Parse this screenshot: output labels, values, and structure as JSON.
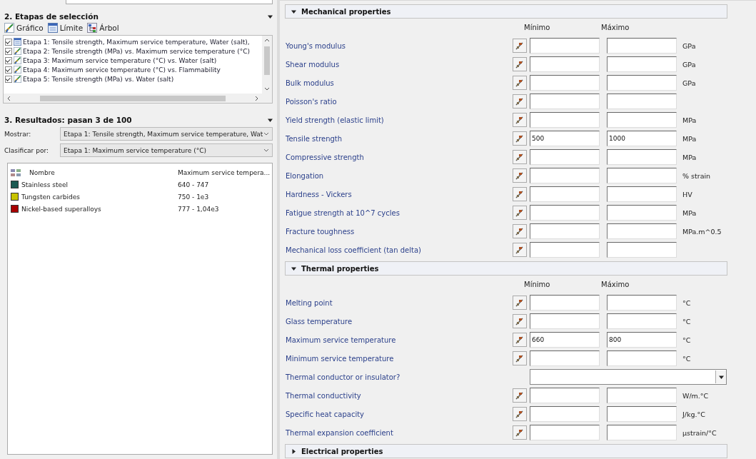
{
  "selection_stages": {
    "title": "2. Etapas de selección",
    "toolbar": [
      {
        "label": "Gráfico",
        "kind": "chart"
      },
      {
        "label": "Límite",
        "kind": "limit"
      },
      {
        "label": "Árbol",
        "kind": "tree"
      }
    ],
    "stages": [
      {
        "label": "Etapa 1: Tensile strength, Maximum service temperature, Water (salt),",
        "kind": "limit",
        "checked": true
      },
      {
        "label": "Etapa 2: Tensile strength (MPa) vs. Maximum service temperature (°C)",
        "kind": "chart",
        "checked": true
      },
      {
        "label": "Etapa 3: Maximum service temperature (°C) vs. Water (salt)",
        "kind": "chart",
        "checked": true
      },
      {
        "label": "Etapa 4: Maximum service temperature (°C) vs. Flammability",
        "kind": "chart",
        "checked": true
      },
      {
        "label": "Etapa 5: Tensile strength (MPa) vs. Water (salt)",
        "kind": "chart",
        "checked": true
      }
    ]
  },
  "results": {
    "title": "3. Resultados: pasan 3 de 100",
    "show_label": "Mostrar:",
    "show_value": "Etapa 1: Tensile strength, Maximum service temperature, Wat",
    "sort_label": "Clasificar por:",
    "sort_value": "Etapa 1: Maximum service temperature (°C)",
    "columns": [
      "Nombre",
      "Maximum service tempera..."
    ],
    "rows": [
      {
        "name": "Stainless steel",
        "value": "640 - 747",
        "color": "#1c5a52"
      },
      {
        "name": "Tungsten carbides",
        "value": "750 - 1e3",
        "color": "#c8c400"
      },
      {
        "name": "Nickel-based superalloys",
        "value": "777 - 1,04e3",
        "color": "#a80000"
      }
    ]
  },
  "property_groups": [
    {
      "title": "Mechanical properties",
      "expanded": true,
      "min_heading": "Mínimo",
      "max_heading": "Máximo",
      "properties": [
        {
          "label": "Young's modulus",
          "kind": "range",
          "unit": "GPa"
        },
        {
          "label": "Shear modulus",
          "kind": "range",
          "unit": "GPa"
        },
        {
          "label": "Bulk modulus",
          "kind": "range",
          "unit": "GPa"
        },
        {
          "label": "Poisson's ratio",
          "kind": "range"
        },
        {
          "label": "Yield strength (elastic limit)",
          "kind": "range",
          "unit": "MPa"
        },
        {
          "label": "Tensile strength",
          "kind": "range",
          "min": "500",
          "max": "1000",
          "unit": "MPa"
        },
        {
          "label": "Compressive strength",
          "kind": "range",
          "unit": "MPa"
        },
        {
          "label": "Elongation",
          "kind": "range",
          "unit": "% strain"
        },
        {
          "label": "Hardness - Vickers",
          "kind": "range",
          "unit": "HV"
        },
        {
          "label": "Fatigue strength at 10^7 cycles",
          "kind": "range",
          "unit": "MPa"
        },
        {
          "label": "Fracture toughness",
          "kind": "range",
          "unit": "MPa.m^0.5"
        },
        {
          "label": "Mechanical loss coefficient (tan delta)",
          "kind": "range"
        }
      ]
    },
    {
      "title": "Thermal properties",
      "expanded": true,
      "min_heading": "Mínimo",
      "max_heading": "Máximo",
      "properties": [
        {
          "label": "Melting point",
          "kind": "range",
          "unit": "°C"
        },
        {
          "label": "Glass temperature",
          "kind": "range",
          "unit": "°C"
        },
        {
          "label": "Maximum service temperature",
          "kind": "range",
          "min": "660",
          "max": "800",
          "unit": "°C"
        },
        {
          "label": "Minimum service temperature",
          "kind": "range",
          "unit": "°C"
        },
        {
          "label": "Thermal conductor or insulator?",
          "kind": "select"
        },
        {
          "label": "Thermal conductivity",
          "kind": "range",
          "unit": "W/m.°C"
        },
        {
          "label": "Specific heat capacity",
          "kind": "range",
          "unit": "J/kg.°C"
        },
        {
          "label": "Thermal expansion coefficient",
          "kind": "range",
          "unit": "µstrain/°C"
        }
      ]
    },
    {
      "title": "Electrical properties",
      "expanded": false
    }
  ]
}
